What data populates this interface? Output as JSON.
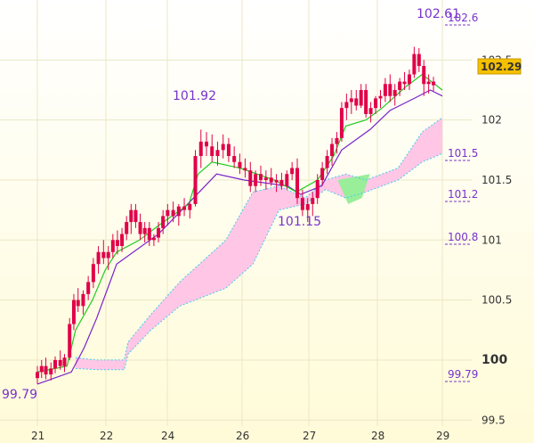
{
  "chart_data": {
    "type": "candlestick",
    "x_ticks": [
      "21",
      "22",
      "24",
      "26",
      "27",
      "28",
      "29"
    ],
    "y_ticks": [
      "99.5",
      "100",
      "100.5",
      "101",
      "101.5",
      "102",
      "102.5"
    ],
    "ylim": [
      99.45,
      103.0
    ],
    "highlight_level": "100",
    "last_price": "102.29",
    "annotations": {
      "high_top": "102.61",
      "high_left": "101.92",
      "low_mid": "101.15",
      "low_left": "99.79"
    },
    "right_partial_labels": [
      "102.6",
      "101.5",
      "101.2",
      "100.8",
      "99.79"
    ],
    "colors": {
      "candle": "#e0004a",
      "conversion_line": "#22cc22",
      "base_line": "#7722cc",
      "cloud_bear": "#ffc6e6",
      "cloud_bull": "#99ee99",
      "cloud_edge": "#44ccee",
      "annotation": "#7733cc",
      "grid": "#ece6c4",
      "price_box": "#f5c000"
    },
    "background_gradient": [
      "#ffffff",
      "#fffbd8"
    ],
    "grid": true,
    "candles": [
      [
        0,
        99.85,
        99.95,
        99.8,
        99.9
      ],
      [
        0.05,
        99.9,
        100.0,
        99.85,
        99.95
      ],
      [
        0.1,
        99.95,
        100.02,
        99.84,
        99.88
      ],
      [
        0.16,
        99.88,
        99.98,
        99.83,
        99.93
      ],
      [
        0.21,
        99.93,
        100.03,
        99.89,
        100.0
      ],
      [
        0.27,
        100.0,
        100.08,
        99.92,
        99.95
      ],
      [
        0.32,
        99.95,
        100.05,
        99.9,
        100.02
      ],
      [
        0.38,
        100.02,
        100.35,
        100.0,
        100.3
      ],
      [
        0.43,
        100.3,
        100.55,
        100.25,
        100.5
      ],
      [
        0.48,
        100.5,
        100.6,
        100.4,
        100.45
      ],
      [
        0.54,
        100.45,
        100.58,
        100.38,
        100.55
      ],
      [
        0.6,
        100.55,
        100.7,
        100.5,
        100.65
      ],
      [
        0.66,
        100.65,
        100.85,
        100.6,
        100.8
      ],
      [
        0.72,
        100.8,
        100.95,
        100.72,
        100.9
      ],
      [
        0.78,
        100.9,
        101.0,
        100.8,
        100.85
      ],
      [
        0.84,
        100.85,
        100.95,
        100.75,
        100.9
      ],
      [
        0.9,
        100.9,
        101.05,
        100.85,
        101.0
      ],
      [
        0.96,
        101.0,
        101.08,
        100.88,
        100.95
      ],
      [
        1.02,
        100.95,
        101.1,
        100.9,
        101.05
      ],
      [
        1.08,
        101.05,
        101.2,
        101.0,
        101.15
      ],
      [
        1.14,
        101.15,
        101.3,
        101.05,
        101.25
      ],
      [
        1.2,
        101.25,
        101.3,
        101.1,
        101.15
      ],
      [
        1.26,
        101.15,
        101.22,
        101.0,
        101.05
      ],
      [
        1.32,
        101.05,
        101.15,
        100.98,
        101.1
      ],
      [
        1.38,
        101.1,
        101.15,
        100.95,
        101.0
      ],
      [
        1.44,
        101.0,
        101.05,
        100.95,
        101.02
      ],
      [
        1.5,
        101.02,
        101.15,
        100.98,
        101.1
      ],
      [
        1.56,
        101.1,
        101.25,
        101.05,
        101.2
      ],
      [
        1.62,
        101.2,
        101.3,
        101.12,
        101.25
      ],
      [
        1.68,
        101.25,
        101.32,
        101.15,
        101.2
      ],
      [
        1.74,
        101.2,
        101.3,
        101.12,
        101.28
      ],
      [
        1.8,
        101.28,
        101.35,
        101.2,
        101.25
      ],
      [
        1.86,
        101.25,
        101.32,
        101.18,
        101.3
      ],
      [
        1.92,
        101.3,
        101.75,
        101.28,
        101.7
      ],
      [
        1.98,
        101.7,
        101.92,
        101.6,
        101.82
      ],
      [
        2.04,
        101.82,
        101.9,
        101.7,
        101.78
      ],
      [
        2.1,
        101.78,
        101.88,
        101.65,
        101.7
      ],
      [
        2.16,
        101.7,
        101.82,
        101.62,
        101.75
      ],
      [
        2.22,
        101.75,
        101.88,
        101.68,
        101.8
      ],
      [
        2.28,
        101.8,
        101.85,
        101.65,
        101.7
      ],
      [
        2.34,
        101.7,
        101.78,
        101.6,
        101.65
      ],
      [
        2.4,
        101.65,
        101.72,
        101.55,
        101.6
      ],
      [
        2.46,
        101.6,
        101.68,
        101.52,
        101.58
      ],
      [
        2.52,
        101.58,
        101.65,
        101.4,
        101.45
      ],
      [
        2.58,
        101.45,
        101.58,
        101.4,
        101.55
      ],
      [
        2.64,
        101.55,
        101.62,
        101.45,
        101.5
      ],
      [
        2.7,
        101.5,
        101.58,
        101.42,
        101.52
      ],
      [
        2.76,
        101.52,
        101.6,
        101.45,
        101.48
      ],
      [
        2.82,
        101.48,
        101.55,
        101.4,
        101.5
      ],
      [
        2.88,
        101.5,
        101.56,
        101.42,
        101.45
      ],
      [
        2.94,
        101.45,
        101.58,
        101.42,
        101.55
      ],
      [
        3.0,
        101.55,
        101.65,
        101.5,
        101.6
      ],
      [
        3.06,
        101.6,
        101.68,
        101.3,
        101.35
      ],
      [
        3.12,
        101.35,
        101.42,
        101.2,
        101.25
      ],
      [
        3.18,
        101.25,
        101.35,
        101.15,
        101.3
      ],
      [
        3.24,
        101.3,
        101.4,
        101.2,
        101.35
      ],
      [
        3.3,
        101.35,
        101.55,
        101.3,
        101.5
      ],
      [
        3.36,
        101.5,
        101.65,
        101.45,
        101.6
      ],
      [
        3.42,
        101.6,
        101.75,
        101.55,
        101.7
      ],
      [
        3.48,
        101.7,
        101.85,
        101.62,
        101.8
      ],
      [
        3.54,
        101.8,
        101.9,
        101.72,
        101.85
      ],
      [
        3.6,
        101.85,
        102.15,
        101.82,
        102.1
      ],
      [
        3.66,
        102.1,
        102.22,
        102.0,
        102.15
      ],
      [
        3.72,
        102.15,
        102.25,
        102.05,
        102.18
      ],
      [
        3.78,
        102.18,
        102.25,
        102.08,
        102.12
      ],
      [
        3.84,
        102.12,
        102.3,
        102.1,
        102.25
      ],
      [
        3.9,
        102.25,
        102.3,
        102.02,
        102.05
      ],
      [
        3.96,
        102.05,
        102.15,
        101.98,
        102.1
      ],
      [
        4.02,
        102.1,
        102.2,
        102.05,
        102.18
      ],
      [
        4.08,
        102.18,
        102.25,
        102.1,
        102.2
      ],
      [
        4.14,
        102.2,
        102.35,
        102.15,
        102.3
      ],
      [
        4.2,
        102.3,
        102.38,
        102.15,
        102.2
      ],
      [
        4.26,
        102.2,
        102.3,
        102.12,
        102.25
      ],
      [
        4.32,
        102.25,
        102.35,
        102.2,
        102.32
      ],
      [
        4.38,
        102.32,
        102.4,
        102.25,
        102.3
      ],
      [
        4.44,
        102.3,
        102.42,
        102.25,
        102.38
      ],
      [
        4.5,
        102.38,
        102.61,
        102.35,
        102.55
      ],
      [
        4.56,
        102.55,
        102.6,
        102.4,
        102.45
      ],
      [
        4.62,
        102.45,
        102.5,
        102.2,
        102.3
      ],
      [
        4.68,
        102.3,
        102.38,
        102.22,
        102.32
      ],
      [
        4.74,
        102.32,
        102.36,
        102.24,
        102.29
      ]
    ],
    "conversion_line": [
      [
        0.0,
        99.9
      ],
      [
        0.35,
        99.95
      ],
      [
        0.45,
        100.25
      ],
      [
        0.65,
        100.5
      ],
      [
        0.8,
        100.75
      ],
      [
        0.95,
        100.9
      ],
      [
        1.25,
        101.0
      ],
      [
        1.5,
        101.12
      ],
      [
        1.85,
        101.3
      ],
      [
        1.95,
        101.55
      ],
      [
        2.1,
        101.65
      ],
      [
        2.4,
        101.6
      ],
      [
        2.8,
        101.5
      ],
      [
        3.05,
        101.4
      ],
      [
        3.3,
        101.5
      ],
      [
        3.5,
        101.7
      ],
      [
        3.65,
        101.95
      ],
      [
        3.9,
        102.0
      ],
      [
        4.1,
        102.1
      ],
      [
        4.4,
        102.28
      ],
      [
        4.6,
        102.38
      ],
      [
        4.85,
        102.25
      ]
    ],
    "base_line": [
      [
        0.0,
        99.8
      ],
      [
        0.4,
        99.9
      ],
      [
        0.55,
        100.1
      ],
      [
        0.7,
        100.35
      ],
      [
        0.95,
        100.8
      ],
      [
        1.5,
        101.05
      ],
      [
        1.9,
        101.35
      ],
      [
        2.15,
        101.55
      ],
      [
        2.45,
        101.5
      ],
      [
        2.95,
        101.45
      ],
      [
        3.1,
        101.38
      ],
      [
        3.35,
        101.45
      ],
      [
        3.6,
        101.75
      ],
      [
        3.95,
        101.92
      ],
      [
        4.2,
        102.08
      ],
      [
        4.5,
        102.18
      ],
      [
        4.7,
        102.25
      ],
      [
        4.85,
        102.2
      ]
    ],
    "cloud_upper": [
      [
        0.45,
        100.02
      ],
      [
        0.7,
        100.0
      ],
      [
        1.05,
        100.0
      ],
      [
        1.1,
        100.15
      ],
      [
        1.4,
        100.38
      ],
      [
        1.75,
        100.65
      ],
      [
        2.25,
        101.0
      ],
      [
        2.55,
        101.4
      ],
      [
        2.85,
        101.45
      ],
      [
        3.15,
        101.35
      ],
      [
        3.4,
        101.5
      ],
      [
        3.65,
        101.55
      ],
      [
        3.9,
        101.5
      ],
      [
        4.3,
        101.6
      ],
      [
        4.6,
        101.9
      ],
      [
        4.85,
        102.02
      ]
    ],
    "cloud_lower": [
      [
        0.45,
        99.93
      ],
      [
        0.7,
        99.92
      ],
      [
        1.05,
        99.92
      ],
      [
        1.1,
        100.05
      ],
      [
        1.4,
        100.25
      ],
      [
        1.75,
        100.45
      ],
      [
        2.25,
        100.6
      ],
      [
        2.55,
        100.8
      ],
      [
        2.85,
        101.25
      ],
      [
        3.15,
        101.3
      ],
      [
        3.4,
        101.42
      ],
      [
        3.65,
        101.35
      ],
      [
        3.9,
        101.4
      ],
      [
        4.3,
        101.5
      ],
      [
        4.6,
        101.65
      ],
      [
        4.85,
        101.72
      ]
    ],
    "x_tick_positions": [
      0,
      1,
      2,
      3,
      3.95,
      5,
      6.0
    ]
  }
}
